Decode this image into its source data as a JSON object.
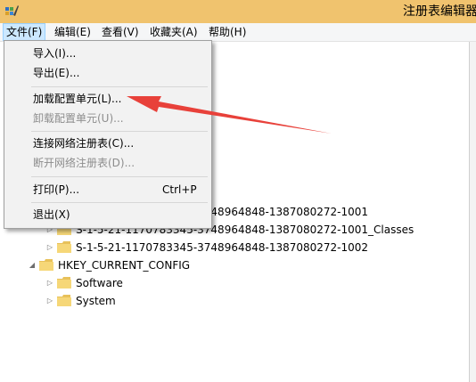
{
  "window": {
    "title": "注册表编辑器"
  },
  "menubar": {
    "items": [
      {
        "label": "文件(F)",
        "active": true
      },
      {
        "label": "编辑(E)",
        "active": false
      },
      {
        "label": "查看(V)",
        "active": false
      },
      {
        "label": "收藏夹(A)",
        "active": false
      },
      {
        "label": "帮助(H)",
        "active": false
      }
    ]
  },
  "file_menu": {
    "items": [
      {
        "label": "导入(I)...",
        "disabled": false
      },
      {
        "label": "导出(E)...",
        "disabled": false
      },
      {
        "label": "加载配置单元(L)...",
        "disabled": false
      },
      {
        "label": "卸载配置单元(U)...",
        "disabled": true
      },
      {
        "label": "连接网络注册表(C)...",
        "disabled": false
      },
      {
        "label": "断开网络注册表(D)...",
        "disabled": true
      },
      {
        "label": "打印(P)...",
        "disabled": false,
        "shortcut": "Ctrl+P"
      },
      {
        "label": "退出(X)",
        "disabled": false
      }
    ]
  },
  "tree": {
    "rows": [
      {
        "label": "S-1-5-21-1170783345-3748964848-1387080272-1001",
        "expander": "▷"
      },
      {
        "label": "S-1-5-21-1170783345-3748964848-1387080272-1001_Classes",
        "expander": "▷"
      },
      {
        "label": "S-1-5-21-1170783345-3748964848-1387080272-1002",
        "expander": "▷"
      },
      {
        "label": "HKEY_CURRENT_CONFIG",
        "expander": "◢"
      },
      {
        "label": "Software",
        "expander": "▷"
      },
      {
        "label": "System",
        "expander": "▷"
      }
    ]
  },
  "colors": {
    "titlebar": "#f0c36e",
    "menubar": "#f5f6f7",
    "menu_active": "#cce8ff",
    "arrow": "#e8413a",
    "folder": "#e8c15a"
  }
}
